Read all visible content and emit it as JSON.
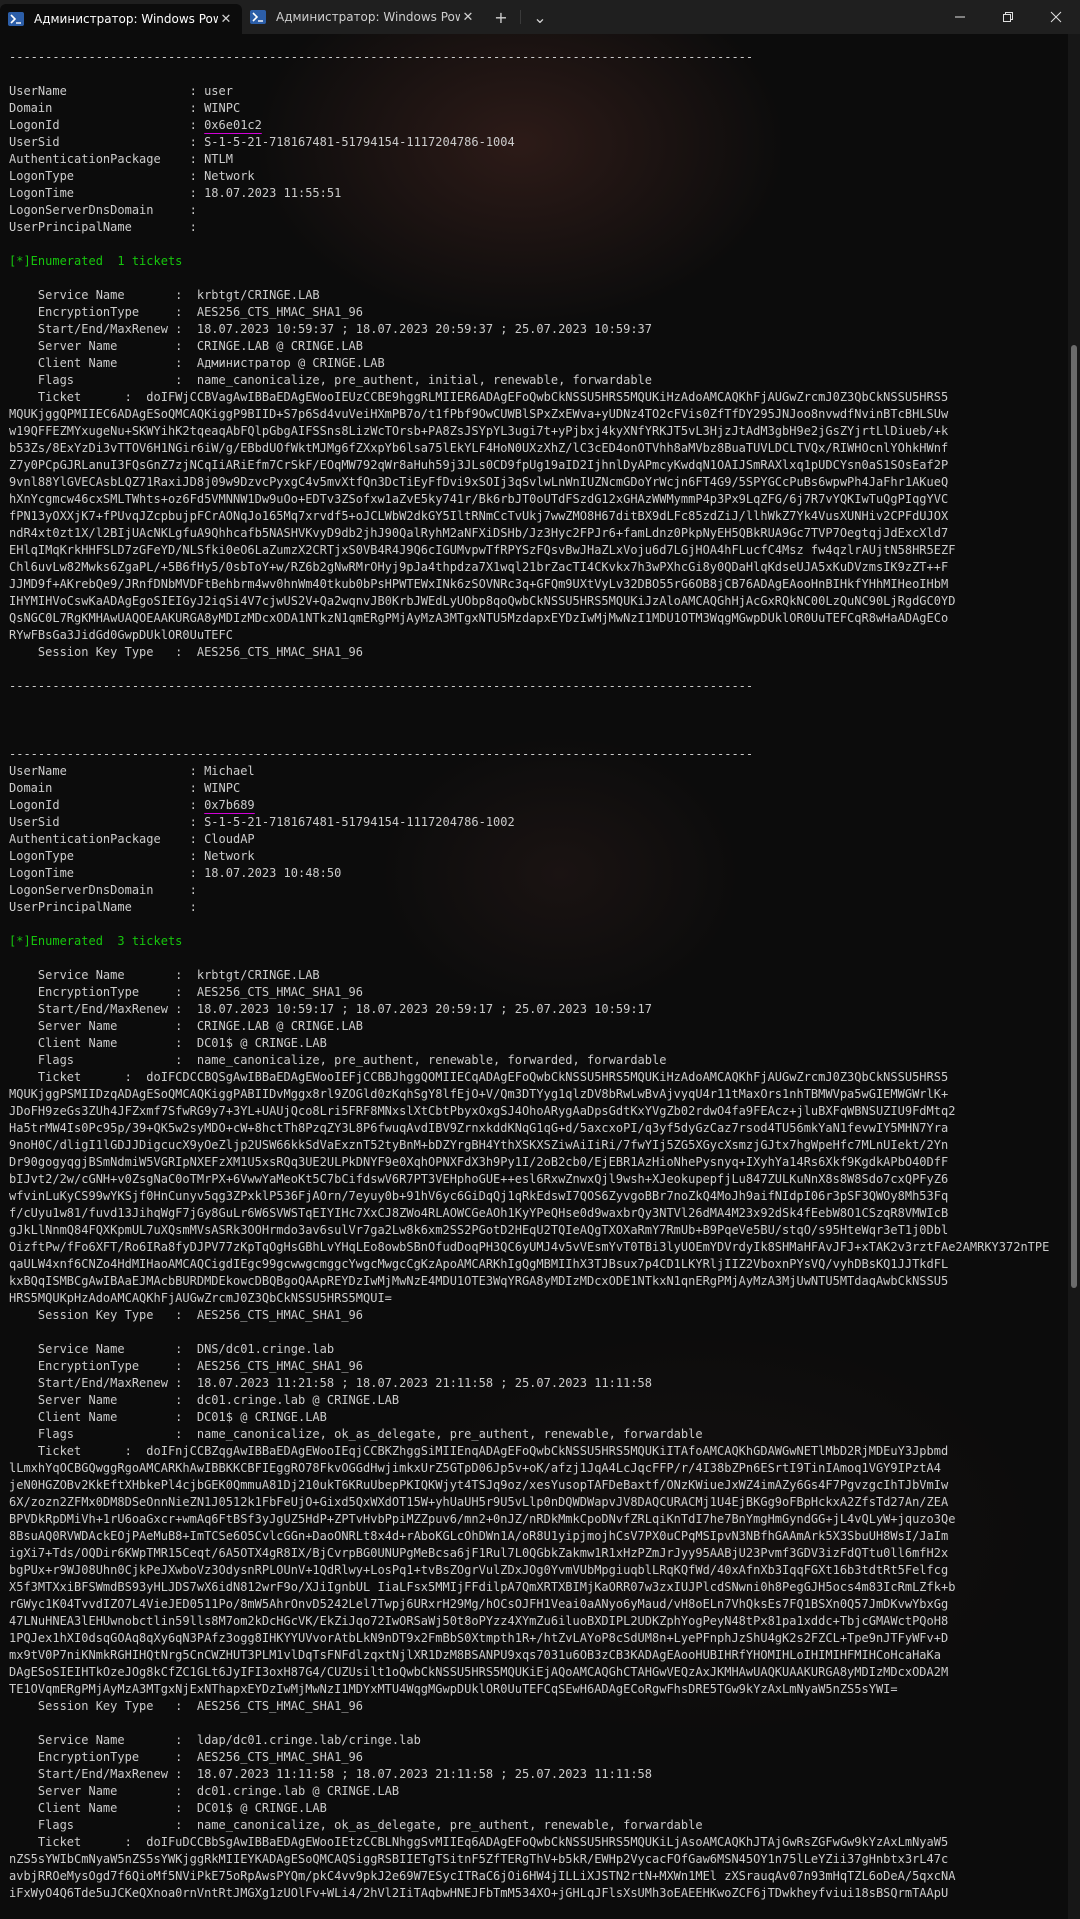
{
  "window": {
    "tabs": [
      {
        "title": "Администратор: Windows PowerShell",
        "active": true
      },
      {
        "title": "Администратор: Windows PowerShell",
        "active": false
      }
    ],
    "new_tab_symbol": "+",
    "dropdown_symbol": "⌄"
  },
  "colors": {
    "background": "#0c0c0c",
    "text": "#cccccc",
    "green": "#16c60c",
    "highlight": "#d200d8"
  },
  "scrollbar": {
    "position_fraction": 0.33,
    "visible_fraction": 0.5
  },
  "terminal": {
    "lines": [
      {
        "t": "-------------------------------------------------------------------------------------------------------"
      },
      {
        "t": ""
      },
      {
        "t": "UserName                 : user"
      },
      {
        "t": "Domain                   : WINPC"
      },
      {
        "t": "LogonId                  : ",
        "m": "0x6e01c2"
      },
      {
        "t": "UserSid                  : S-1-5-21-718167481-51794154-1117204786-1004"
      },
      {
        "t": "AuthenticationPackage    : NTLM"
      },
      {
        "t": "LogonType                : Network"
      },
      {
        "t": "LogonTime                : 18.07.2023 11:55:51"
      },
      {
        "t": "LogonServerDnsDomain     :"
      },
      {
        "t": "UserPrincipalName        :"
      },
      {
        "t": ""
      },
      {
        "t": "[*]Enumerated  1 tickets",
        "c": "green"
      },
      {
        "t": ""
      },
      {
        "t": "    Service Name       :  krbtgt/CRINGE.LAB"
      },
      {
        "t": "    EncryptionType     :  AES256_CTS_HMAC_SHA1_96"
      },
      {
        "t": "    Start/End/MaxRenew :  18.07.2023 10:59:37 ; 18.07.2023 20:59:37 ; 25.07.2023 10:59:37"
      },
      {
        "t": "    Server Name        :  CRINGE.LAB @ CRINGE.LAB"
      },
      {
        "t": "    Client Name        :  Администратор @ CRINGE.LAB"
      },
      {
        "t": "    Flags              :  name_canonicalize, pre_authent, initial, renewable, forwardable"
      },
      {
        "t": "    Ticket      :  doIFWjCCBVagAwIBBaEDAgEWooIEUzCCBE9hggRLMIIER6ADAgEFoQwbCkNSSU5HRS5MQUKiHzAdoAMCAQKhFjAUGwZrcmJ0Z3QbCkNSSU5HRS5"
      },
      {
        "t": "MQUKjggQPMIIEC6ADAgESoQMCAQKiggP9BIID+S7p6Sd4vuVeiHXmPB7o/t1fPbf9OwCUWBlSPxZxEWva+yUDNz4TO2cFVis0ZfTfDY295JNJoo8nvwdfNvinBTcBHLSUw"
      },
      {
        "t": "w19QFFEZMYxugeNu+SKWYihK2tqeaqAbFQlpGbgAIFSSns8LizWcTOrsb+PA8ZsJSYpYL3ugi7t+yPjbxj4kyXNfYRKJT5vL3HjzJtAdM3gbH9e2jGsZYjrtLlDiueb/+k"
      },
      {
        "t": "b53Zs/8ExYzDi3vTTOV6H1NGir6iW/g/EBbdUOfWktMJMg6fZXxpYb6lsa75lEkYLF4HoN0UXzXhZ/lC3cED4onOTVhh8aMVbz8BuaTUVLDCLTVQx/RIWHOcnlYOhkHWnf"
      },
      {
        "t": "Z7y0PCpGJRLanuI3FQsGnZ7zjNCqIiARiEfm7CrSkF/EOqMW792qWr8aHuh59j3JLs0CD9fpUg19aID2IjhnlDyAPmcyKwdqN1OAIJSmRAXlxq1pUDCYsn0aS1SOsEaf2P"
      },
      {
        "t": "9vnl88YlGVECAsbLQZ71RaxiJD8j09w9DzvcPyxgC4v5mvXtfQn3DcTiEyFfDvi9xSOIj3qSvlwLnWnIUZNcmGDoYrWcjn6FT4G9/5SPYGCcPuBs6wpwPh4JaFhr1AKueQ"
      },
      {
        "t": "hXnYcgmcw46cxSMLTWhts+oz6Fd5VMNNW1Dw9uOo+EDTv3ZSofxw1aZvE5ky741r/Bk6rbJT0oUTdFSzdG12xGHAzWWMymmP4p3Px9LqZFG/6j7R7vYQKIwTuQgPIqgYVC"
      },
      {
        "t": "fPN13yOXXjK7+fPUvqJZcpbujpFCrAONqJo165Mq7xrvdf5+oJCLWbW2dkGY5IltRNmCcTvUkj7wwZMO8H67ditBX9dLFc85zdZiJ/llhWkZ7Yk4VusXUNHiv2CPFdUJOX"
      },
      {
        "t": "ndR4xt0zt1X/l2BIjUAcNKLgfuA9Qhhcafb5NASHVKvyD9db2jhJ90QalRyhM2aNFXiDSHb/Jz3Hyc2FPJr6+famLdnz0PkpNyEH5QBkRUA9Gc7TVP7OegtqjJdExcXld7"
      },
      {
        "t": "EHlqIMqKrkHHFSLD7zGFeYD/NLSfki0eO6LaZumzX2CRTjxS0VB4R4J9Q6cIGUMvpwTfRPYSzFQsvBwJHaZLxVoju6d7LGjHOA4hFLucfC4Msz fw4qzlrAUjtN58HR5EZF"
      },
      {
        "t": "Chl6uvLw82Mwks6ZgaPL/+5B6fHy5/0sbToY+w/RZ6b2gNwRMrOHyj9pJa4thpdza7X1wql21brZacTI4CKvkx7h3wPXhcGi8y0QDaHlqKdseUJA5xKuDVzmsIK9zZT++F"
      },
      {
        "t": "JJMD9f+AKrebQe9/JRnfDNbMVDFtBehbrm4wv0hnWm40tkub0bPsHPWTEWxINk6zSOVNRc3q+GFQm9UXtVyLv32DBO55rG6OB8jCB76ADAgEAooHnBIHkfYHhMIHeoIHbM"
      },
      {
        "t": "IHYMIHVoCswKaADAgEgoSIEIGyJ2iqSi4V7cjwUS2V+Qa2wqnvJB0KrbJWEdLyUObp8qoQwbCkNSSU5HRS5MQUKiJzAloAMCAQGhHjAcGxRQkNC00LzQuNC90LjRgdGC0YD"
      },
      {
        "t": "QsNGC0L7RgKMHAwUAQOEAAKURGA8yMDIzMDcxODA1NTkzN1qmERgPMjAyMzA3MTgxNTU5MzdapxEYDzIwMjMwNzI1MDU1OTM3WqgMGwpDUklOR0UuTEFCqR8wHaADAgECo"
      },
      {
        "t": "RYwFBsGa3JidGd0GwpDUklOR0UuTEFC"
      },
      {
        "t": "    Session Key Type   :  AES256_CTS_HMAC_SHA1_96"
      },
      {
        "t": ""
      },
      {
        "t": "-------------------------------------------------------------------------------------------------------"
      },
      {
        "t": ""
      },
      {
        "t": ""
      },
      {
        "t": ""
      },
      {
        "t": "-------------------------------------------------------------------------------------------------------"
      },
      {
        "t": "UserName                 : Michael"
      },
      {
        "t": "Domain                   : WINPC"
      },
      {
        "t": "LogonId                  : ",
        "m": "0x7b689"
      },
      {
        "t": "UserSid                  : S-1-5-21-718167481-51794154-1117204786-1002"
      },
      {
        "t": "AuthenticationPackage    : CloudAP"
      },
      {
        "t": "LogonType                : Network"
      },
      {
        "t": "LogonTime                : 18.07.2023 10:48:50"
      },
      {
        "t": "LogonServerDnsDomain     :"
      },
      {
        "t": "UserPrincipalName        :"
      },
      {
        "t": ""
      },
      {
        "t": "[*]Enumerated  3 tickets",
        "c": "green"
      },
      {
        "t": ""
      },
      {
        "t": "    Service Name       :  krbtgt/CRINGE.LAB"
      },
      {
        "t": "    EncryptionType     :  AES256_CTS_HMAC_SHA1_96"
      },
      {
        "t": "    Start/End/MaxRenew :  18.07.2023 10:59:17 ; 18.07.2023 20:59:17 ; 25.07.2023 10:59:17"
      },
      {
        "t": "    Server Name        :  CRINGE.LAB @ CRINGE.LAB"
      },
      {
        "t": "    Client Name        :  DC01$ @ CRINGE.LAB"
      },
      {
        "t": "    Flags              :  name_canonicalize, pre_authent, renewable, forwarded, forwardable"
      },
      {
        "t": "    Ticket      :  doIFCDCCBQSgAwIBBaEDAgEWooIEFjCCBBJhggQOMIIECqADAgEFoQwbCkNSSU5HRS5MQUKiHzAdoAMCAQKhFjAUGwZrcmJ0Z3QbCkNSSU5HRS5"
      },
      {
        "t": "MQUKjggPSMIIDzqADAgESoQMCAQKiggPABIIDvMggx8rl9ZOGld0zKqhSgY8lfEjO+V/Qm3DTYyg1qlzDV8bRwLwBvAjvyqU4r11tMaxOrs1nhTBMWVpa5wGIEMWGWrlK+"
      },
      {
        "t": "JDoFH9zeGs3ZUh4JFZxmf7SfwRG9y7+3YL+UAUjQco8Lri5FRF8MNxslXtCbtPbyxOxgSJ4OhoARygAaDpsGdtKxYVgZb02rdwO4fa9FEAcz+jluBXFqWBNSUZIU9FdMtq2"
      },
      {
        "t": "Ha5trMW4Is0Pc95p/39+QK5w2syMDO+cW+8hctTh8PzqZY3L8P6fwuqAvdIBV9ZrnxkddKNqG1qG+d/5axcxoPI/q3yf5dyGzCaz7rsod4TU56mkYaN1fevwIY5MHN7Yra"
      },
      {
        "t": "9noH0C/dligI1lGDJJDigcucX9yOeZljp2USW66kkSdVaExznT52tyBnM+bDZYrgBH4YthXSKXSZiwAiIiRi/7fwYIj5ZG5XGycXsmzjGJtx7hgWpeHfc7MLnUIekt/2Yn"
      },
      {
        "t": "Dr90gogyqgjBSmNdmiW5VGRIpNXEFzXM1U5xsRQq3UE2ULPkDNYF9e0XqhOPNXFdX3h9Py1I/2oB2cb0/EjEBR1AzHioNhePysnyq+IXyhYa14Rs6Xkf9KgdkAPbO40DfF"
      },
      {
        "t": "bIJvt2/2w/cGNH+v0ZsgNaC0oTMrPX+6VwwYaMeoKt5C7bCifdswV6R7PT3VEHphoGUE++esl6RxwZnwxQjl9wsh+XJeokupepfjLu847ZULKuNnX8s8W8Sdo7cxQPFyZ6"
      },
      {
        "t": "wfvinLuKyCS99wYKSjf0HnCunyv5qg3ZPxklP536FjAOrn/7eyuy0b+91hV6yc6GiDqQj1qRkEdswI7QOS6ZyvgoBBr7noZkQ4MoJh9aifNIdpI06r3pSF3QWOy8Mh53Fq"
      },
      {
        "t": "f/cUyu1w81/fuvd13JihqWgF7jGy8GuLr6W6SVWSTqEIYIHc7XxCJ8ZWo4RLAOWCGeAOh1KyYPeQHse0d9waxbrQy3NTVl26dMA4M23x92dSk4fEebW8O1CSzqR8VMWIcB"
      },
      {
        "t": "gJkLlNnmQ84FQXKpmUL7uXQsmMVsASRk3OOHrmdo3av6sulVr7ga2Lw8k6xm2SS2PGotD2HEqU2TQIeAQgTXOXaRmY7RmUb+B9PqeVe5BU/stqO/s95HteWqr3eT1j0Dbl"
      },
      {
        "t": "OizftPw/fFo6XFT/Ro6IRa8fyDJPV77zKpTqOgHsGBhLvYHqLEo8owbSBnOfudDoqPH3QC6yUMJ4v5vVEsmYvT0TBi3lyUOEmYDVrdyIk8SHMaHFAvJFJ+xTAK2v3rztFAe2AMRKY372nTPE0"
      },
      {
        "t": "qaULW4xnf6CNZo4HdMIHaoAMCAQCigdIEgc99gcwwgcmggcYwgcMwgcCgKzApoAMCARKhIgQgMBMIIhX3TJBsux7p4CD1LKYRljIIZ2VboxnPYsVQ/vyhDBsKQ1JJTkdFL"
      },
      {
        "t": "kxBQqISMBCgAwIBAaEJMAcbBURDMDEkowcDBQBgoQAApREYDzIwMjMwNzE4MDU1OTE3WqYRGA8yMDIzMDcxODE1NTkxN1qnERgPMjAyMzA3MjUwNTU5MTdaqAwbCkNSSU5"
      },
      {
        "t": "HRS5MQUKpHzAdoAMCAQKhFjAUGwZrcmJ0Z3QbCkNSSU5HRS5MQUI="
      },
      {
        "t": "    Session Key Type   :  AES256_CTS_HMAC_SHA1_96"
      },
      {
        "t": ""
      },
      {
        "t": "    Service Name       :  DNS/dc01.cringe.lab"
      },
      {
        "t": "    EncryptionType     :  AES256_CTS_HMAC_SHA1_96"
      },
      {
        "t": "    Start/End/MaxRenew :  18.07.2023 11:21:58 ; 18.07.2023 21:11:58 ; 25.07.2023 11:11:58"
      },
      {
        "t": "    Server Name        :  dc01.cringe.lab @ CRINGE.LAB"
      },
      {
        "t": "    Client Name        :  DC01$ @ CRINGE.LAB"
      },
      {
        "t": "    Flags              :  name_canonicalize, ok_as_delegate, pre_authent, renewable, forwardable"
      },
      {
        "t": "    Ticket      :  doIFnjCCBZqgAwIBBaEDAgEWooIEqjCCBKZhggSiMIIEnqADAgEFoQwbCkNSSU5HRS5MQUKiITAfoAMCAQKhGDAWGwNETlMbD2RjMDEuY3Jpbmd"
      },
      {
        "t": "lLmxhYqOCBGQwggRgoAMCARKhAwIBBKKCBFIEggRO78FkvOGGdHwjimkxUrZ5GTpD06Jp5v+oK/afzj1JqA4LcJqcFFP/r/4I38bZPn6ESrtI9TinIAmoq1VGY9IPztA4"
      },
      {
        "t": "jeN0HGZOBv2KkEftXHbkePl4cjbGEK0QmmuA81Dj210ukT6KRuUbepPKIQKWjyt4TSJq9oz/xesYusopTAFDeBaxtf/ONzKWiueJxWZ4imAZy6Gs4F7PgvzgcIhTJbVmIw"
      },
      {
        "t": "6X/zozn2ZFMx0DM8DSeOnnNieZN1J0512k1FbFeUjO+Gixd5QxWXdOT15W+yhUaUH5r9U5vLlp0nDQWDWapvJV8DAQCURACMj1U4EjBKGg9oFBpHckxA2ZfsTd27An/ZEA"
      },
      {
        "t": "BPVDkRpDMiVh+1rU6oaGxcr+wmAq6FtBSf3yJgUZ5HdP+ZPTvHvbPpiMZZpuv6/mn2+0nJZ/nRDkMmkCpoDNvfZRLqiKnTdI7he7BnYmgHmGyndGG+jL4vQLyW+jquzo3Qe"
      },
      {
        "t": "8BsuAQ0RVWDAckEOjPAeMuB8+ImTCSe6O5CvlcGGn+DaoONRLt8x4d+rAboKGLcOhDWn1A/oR8U1yipjmojhCsV7PX0uCPqMSIpvN3NBfhGAAmArk5X3SbuUH8WsI/JaIm"
      },
      {
        "t": "igXi7+Tds/OQDir6KWpTMR15Ceqt/6A5OTX4gR8IX/BjCvrpBG0UNUPgMeBcsa6jF1Rul7L0QGbkZakmw1R1xHzPZmJrJyy95AABjU23Pvmf3GDV3izFdQTtu0ll6mfH2x"
      },
      {
        "t": "bgPUx+r9WJ08Uhn0CjkPeJXwboVz3OdysnRPLOUnV+1QdRlwy+LosPq1+tvBsZOgrVulZDxJOg0YvmVUbMpgiuqblLRqKQfWd/40xAfnXb3IqqFGXt16b3tdtRt5Felfcg"
      },
      {
        "t": "X5f3MTXxiBFSWmdBS93yHLJDS7wX6idN812wrF9o/XJiIgnbUL IiaLFsx5MMIjFFdilpA7QmXRTXBIMjKaORR07w3zxIUJPlcdSNwni0h8PegGJH5ocs4m83IcRmLZfk+b"
      },
      {
        "t": "rGWyc1K04TvvdIZO7L4VieJED0511Po/8mW5AhrOnvD5242Lel7Twpj6URxrH29Mg/hOCsOJFH1Veai0aANyo6yMaud/vH8oELn7VhQksEs7FQ1BSXn0Q57JmDKvwYbxGg"
      },
      {
        "t": "47LNuHNEA3lEHUwnobctlin59lls8M7om2kDcHGcVK/EkZiJqo72IwORSaWj50t8oPYzz4XYmZu6iluoBXDIPL2UDKZphYogPeyN48tPx81pa1xddc+TbjcGMAWctPQoH8"
      },
      {
        "t": "1PQJex1hXI0dsqGOAq8qXy6qN3PAfz3ogg8IHKYYUVvorAtbLkN9nDT9x2FmBbS0Xtmpth1R+/htZvLAYoP8cSdUM8n+LyePFnphJzShU4gK2s2FZCL+Tpe9nJTFyWFv+D"
      },
      {
        "t": "mx9tV0P7niKNmkRGHIHQtNrg5CnCWZHUT3PLM1vlDqTsFNFdlzqxtNjlXR1DzM8BSANPU9xqs7031u6OB3zCB3KADAgEAooHUBIHRfYHOMIHLoIHIMIHFMIHCoHcaHaKa"
      },
      {
        "t": "DAgESoSIEIHTkOzeJOg8kCfZC1GLt6JyIFI3oxH87G4/CUZUsilt1oQwbCkNSSU5HRS5MQUKiEjAQoAMCAQGhCTAHGwVEQzAxJKMHAwUAQKUAAKURGA8yMDIzMDcxODA2M"
      },
      {
        "t": "TE1OVqmERgPMjAyMzA3MTgxNjExNThapxEYDzIwMjMwNzI1MDYxMTU4WqgMGwpDUklOR0UuTEFCqSEwH6ADAgECoRgwFhsDRE5TGw9kYzAxLmNyaW5nZS5sYWI="
      },
      {
        "t": "    Session Key Type   :  AES256_CTS_HMAC_SHA1_96"
      },
      {
        "t": ""
      },
      {
        "t": "    Service Name       :  ldap/dc01.cringe.lab/cringe.lab"
      },
      {
        "t": "    EncryptionType     :  AES256_CTS_HMAC_SHA1_96"
      },
      {
        "t": "    Start/End/MaxRenew :  18.07.2023 11:11:58 ; 18.07.2023 21:11:58 ; 25.07.2023 11:11:58"
      },
      {
        "t": "    Server Name        :  dc01.cringe.lab @ CRINGE.LAB"
      },
      {
        "t": "    Client Name        :  DC01$ @ CRINGE.LAB"
      },
      {
        "t": "    Flags              :  name_canonicalize, ok_as_delegate, pre_authent, renewable, forwardable"
      },
      {
        "t": "    Ticket      :  doIFuDCCBbSgAwIBBaEDAgEWooIEtzCCBLNhggSvMIIEq6ADAgEFoQwbCkNSSU5HRS5MQUKiLjAsoAMCAQKhJTAjGwRsZGFwGw9kYzAxLmNyaW5"
      },
      {
        "t": "nZS5sYWIbCmNyaW5nZS5sYWKjggRkMIIEYKADAgESoQMCAQSiggRSBIIETgTSitnF5ZfTERgThV+b5kR/EWHp2VycacFOfGaw6MSN45OY1n75lLeYZii37gHnbtx3rL47c"
      },
      {
        "t": "avbjRROeMysOgd7f6QioMf5NViPkE75oRpAwsPYQm/pkC4vv9pkJ2e69W7ESycITRaC6jOi6HW4jILLiXJSTN2rtN+MXWn1MEl zXSrauqAv07n93mHqTZL6oDeA/5qxcNA"
      },
      {
        "t": "iFxWyO4Q6Tde5uJCKeQXnoa0rnVntRtJMGXg1zUOlFv+WLi4/2hVl2IiTAqbwHNEJFbTmM534XO+jGHLqJFlsXsUMh3oEAEEHKwoZCF6jTDwkheyfviui18sBSQrmTAApU"
      }
    ]
  }
}
